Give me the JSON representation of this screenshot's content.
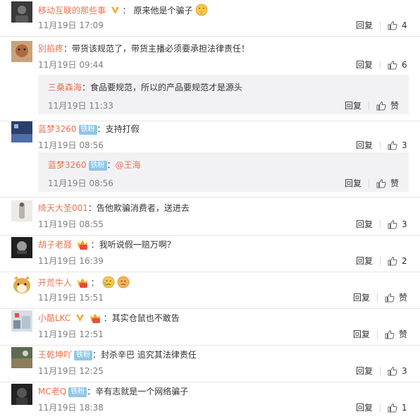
{
  "comments": [
    {
      "user": "移动互联的那些事",
      "text": "原来他是个骗子",
      "time": "11月19日 17:09",
      "reply": "回复",
      "likes": "4"
    },
    {
      "user": "别掐疼",
      "text": "带货该规范了，带货主播必须要承担法律责任！",
      "time": "11月19日 09:44",
      "reply": "回复",
      "likes": "6",
      "subreply": {
        "user": "三桑森海",
        "text": "食品要规范，所以的产品要规范才是源头",
        "time": "11月19日 11:33",
        "reply": "回复",
        "like_label": "赞"
      }
    },
    {
      "user": "蓝梦3260",
      "badge": "铁粉",
      "text": "支持打假",
      "time": "11月19日 08:56",
      "reply": "回复",
      "likes": "3",
      "subreply": {
        "user": "蓝梦3260",
        "badge": "铁粉",
        "mention": "@王海",
        "time": "11月19日 08:56",
        "reply": "回复",
        "like_label": "赞"
      }
    },
    {
      "user": "绮天大圣001",
      "text": "告他欺骗消费者，送进去",
      "time": "11月19日 08:55",
      "reply": "回复",
      "likes": "3"
    },
    {
      "user": "胡子老聂",
      "text": "我听说假一赔万啊？",
      "time": "11月19日 16:39",
      "reply": "回复",
      "likes": "2"
    },
    {
      "user": "开荒牛人",
      "text": "",
      "time": "11月19日 15:51",
      "reply": "回复",
      "like_label": "赞"
    },
    {
      "user": "小酷LKC",
      "text": "其实仓鼠也不敢告",
      "time": "11月19日 12:51",
      "reply": "回复",
      "like_label": "赞"
    },
    {
      "user": "王乾坤吖",
      "badge": "铁粉",
      "text": "封杀辛巴 追究其法律责任",
      "time": "11月19日 12:25",
      "reply": "回复",
      "likes": "3"
    },
    {
      "user": "MC老Q",
      "badge": "铁粉",
      "text": "辛有志就是一个网络骗子",
      "time": "11月19日 18:38",
      "reply": "回复",
      "likes": "1"
    }
  ],
  "separator": "：",
  "colors": {
    "username": "#eb7350",
    "badge": "#8ec6e8",
    "subreply_bg": "#f2f2f5",
    "time": "#808080"
  }
}
